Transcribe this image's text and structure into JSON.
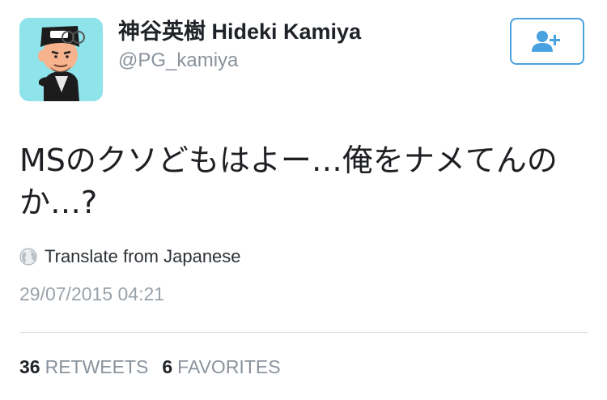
{
  "user": {
    "display_name": "神谷英樹 Hideki Kamiya",
    "handle": "@PG_kamiya"
  },
  "tweet": {
    "text": "MSのクソどもはよー…俺をナメてんのか…?",
    "translate_label": "Translate from Japanese",
    "timestamp": "29/07/2015 04:21"
  },
  "stats": {
    "retweets_count": "36",
    "retweets_label": "RETWEETS",
    "favorites_count": "6",
    "favorites_label": "FAVORITES"
  },
  "icons": {
    "follow": "add-user-icon",
    "translate": "globe-icon"
  },
  "colors": {
    "accent": "#4aa1df",
    "secondary_text": "#8a939c",
    "avatar_background": "#8fe3ea"
  }
}
